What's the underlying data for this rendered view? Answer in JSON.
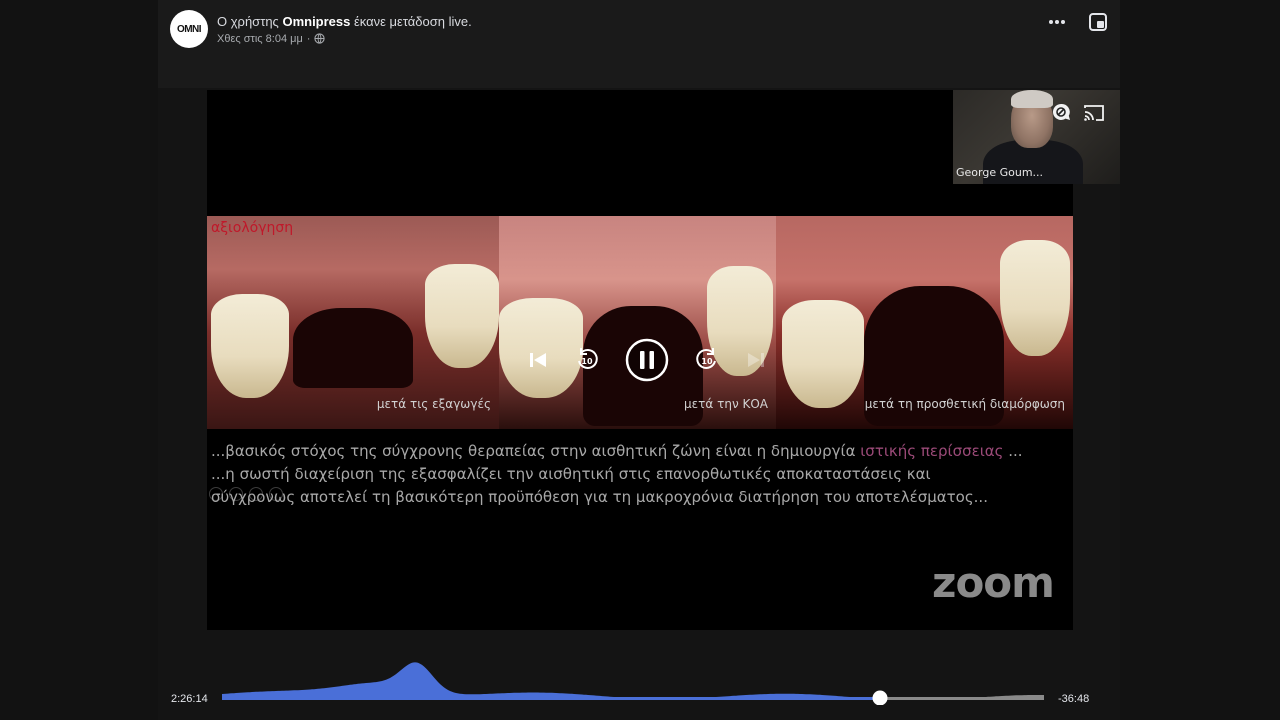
{
  "post": {
    "avatar_text": "OMNI",
    "headline_prefix": "Ο χρήστης ",
    "author": "Omnipress",
    "headline_suffix": " έκανε μετάδοση live.",
    "timestamp": "Χθες στις 8:04 μμ",
    "separator": "·",
    "privacy_icon": "globe-icon"
  },
  "top_actions": {
    "more_icon": "more-horizontal-icon",
    "pip_icon": "picture-in-picture-icon"
  },
  "speaker": {
    "name": "George Goum...",
    "icons": [
      "comment-off-icon",
      "cast-icon"
    ]
  },
  "slide": {
    "tag": "αξιολόγηση",
    "photos": [
      {
        "caption": "μετά τις εξαγωγές"
      },
      {
        "caption": "μετά την ΚΟΑ"
      },
      {
        "caption": "μετά τη προσθετική διαμόρφωση"
      }
    ],
    "line1_pre": "...βασικός στόχος της σύγχρονης θεραπείας  στην αισθητική ζώνη είναι η δημιουργία ",
    "line1_highlight": "ιστικής περίσσειας",
    "line1_post": " ...",
    "line2": "...η σωστή διαχείριση της εξασφαλίζει  την αισθητική  στις επανορθωτικές  αποκαταστάσεις και",
    "line3": "σύγχρονως  αποτελεί  τη βασικότερη προϋπόθεση για τη μακροχρόνια διατήρηση του αποτελέσματος..."
  },
  "watermark": "zoom",
  "player": {
    "controls": [
      "skip-previous-icon",
      "rewind-10-icon",
      "pause-icon",
      "forward-10-icon",
      "skip-next-icon"
    ],
    "elapsed": "2:26:14",
    "remaining": "-36:48",
    "progress": 0.8,
    "colors": {
      "played": "#4a6fd8",
      "unplayed": "#8a8a8a",
      "handle": "#ffffff"
    }
  }
}
